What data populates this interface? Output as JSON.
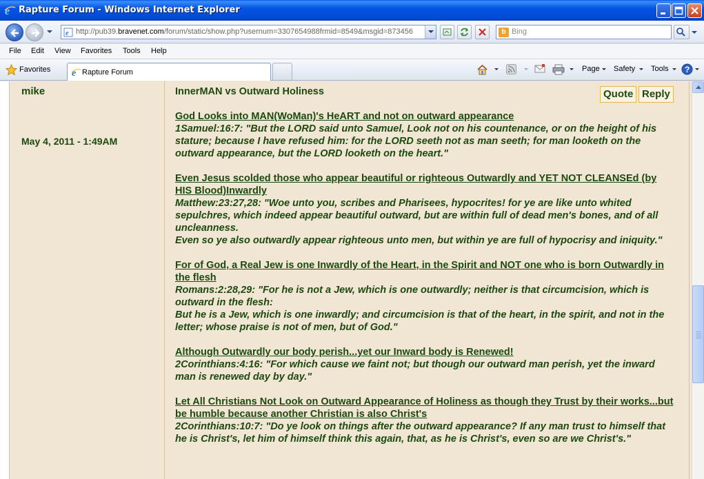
{
  "window": {
    "title": "Rapture Forum - Windows Internet Explorer"
  },
  "address_bar": {
    "url_prefix": "http://pub39.",
    "url_domain": "bravenet.com",
    "url_rest": "/forum/static/show.php?usernum=3307654988frmid=8549&msgid=873456"
  },
  "search": {
    "placeholder": "Bing"
  },
  "menu": [
    "File",
    "Edit",
    "View",
    "Favorites",
    "Tools",
    "Help"
  ],
  "favorites_bar": {
    "favorites_label": "Favorites",
    "tab_title": "Rapture Forum"
  },
  "command_bar": {
    "page_label": "Page",
    "safety_label": "Safety",
    "tools_label": "Tools"
  },
  "post": {
    "author": "mike",
    "date": "May 4, 2011 - 1:49AM",
    "subject": "InnerMAN vs Outward Holiness",
    "quote_label": "Quote",
    "reply_label": "Reply",
    "sections": [
      {
        "heading": "God Looks into MAN(WoMan)'s HeART and not on outward appearance",
        "quote": "1Samuel:16:7: \"But the LORD said unto Samuel, Look not on his countenance, or on the height of his stature; because I have refused him: for the LORD seeth not as man seeth; for man looketh on the outward appearance, but the LORD looketh on the heart.\""
      },
      {
        "heading": "Even Jesus scolded those who appear beautiful or righteous Outwardly and YET NOT CLEANSEd (by HIS Blood)Inwardly",
        "quote": "Matthew:23:27,28: \"Woe unto you, scribes and Pharisees, hypocrites! for ye are like unto whited sepulchres, which indeed appear beautiful outward, but are within full of dead men's bones, and of all uncleanness.",
        "quote2": "Even so ye also outwardly appear righteous unto men, but within ye are full of hypocrisy and iniquity.\""
      },
      {
        "heading": "For of God, a Real Jew is one Inwardly of the Heart, in the Spirit and NOT one who is born Outwardly in the flesh",
        "quote": "Romans:2:28,29: \"For he is not a Jew, which is one outwardly; neither is that circumcision, which is outward in the flesh:",
        "quote2": "But he is a Jew, which is one inwardly; and circumcision is that of the heart, in the spirit, and not in the letter; whose praise is not of men, but of God.\""
      },
      {
        "heading": "Although Outwardly our body perish...yet our Inward body is Renewed!",
        "quote": "2Corinthians:4:16: \"For which cause we faint not; but though our outward man perish, yet the inward man is renewed day by day.\""
      },
      {
        "heading": "Let All Christians Not Look on Outward Appearance of Holiness as though they Trust by their works...but be humble because another Christian is also Christ's",
        "quote": "2Corinthians:10:7: \"Do ye look on things after the outward appearance? If any man trust to himself that he is Christ's, let him of himself think this again, that, as he is Christ's, even so are we Christ's.\""
      }
    ]
  },
  "colors": {
    "post_background": "#f1e5d3",
    "post_text": "#1c4a10",
    "titlebar_blue": "#0554e3"
  }
}
